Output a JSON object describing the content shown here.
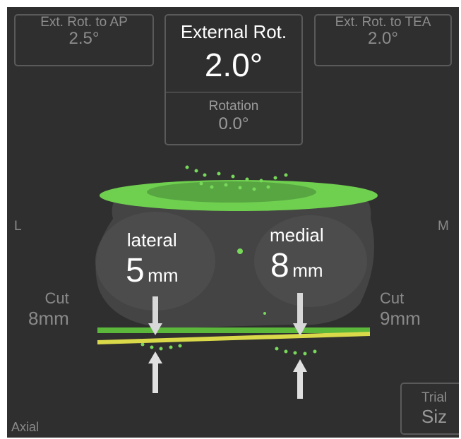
{
  "top_left": {
    "label": "Ext. Rot. to AP",
    "value": "2.5°"
  },
  "center": {
    "title": "External Rot.",
    "value": "2.0°",
    "sub_label": "Rotation",
    "sub_value": "0.0°"
  },
  "top_right": {
    "label": "Ext. Rot. to TEA",
    "value": "2.0°"
  },
  "side_labels": {
    "left": "L",
    "right": "M"
  },
  "lateral": {
    "label": "lateral",
    "value": "5",
    "unit": "mm"
  },
  "medial": {
    "label": "medial",
    "value": "8",
    "unit": "mm"
  },
  "cut_left": {
    "label": "Cut",
    "value": "8mm"
  },
  "cut_right": {
    "label": "Cut",
    "value": "9mm"
  },
  "trial": {
    "label": "Trial",
    "value": "Siz"
  },
  "view": "Axial",
  "colors": {
    "background": "#2f2f2f",
    "plane": "#6fcf4f",
    "cut_line_green": "#5cb83a",
    "cut_line_yellow": "#d9d94a"
  },
  "icons": [
    "arrow-down-icon",
    "arrow-up-icon"
  ]
}
